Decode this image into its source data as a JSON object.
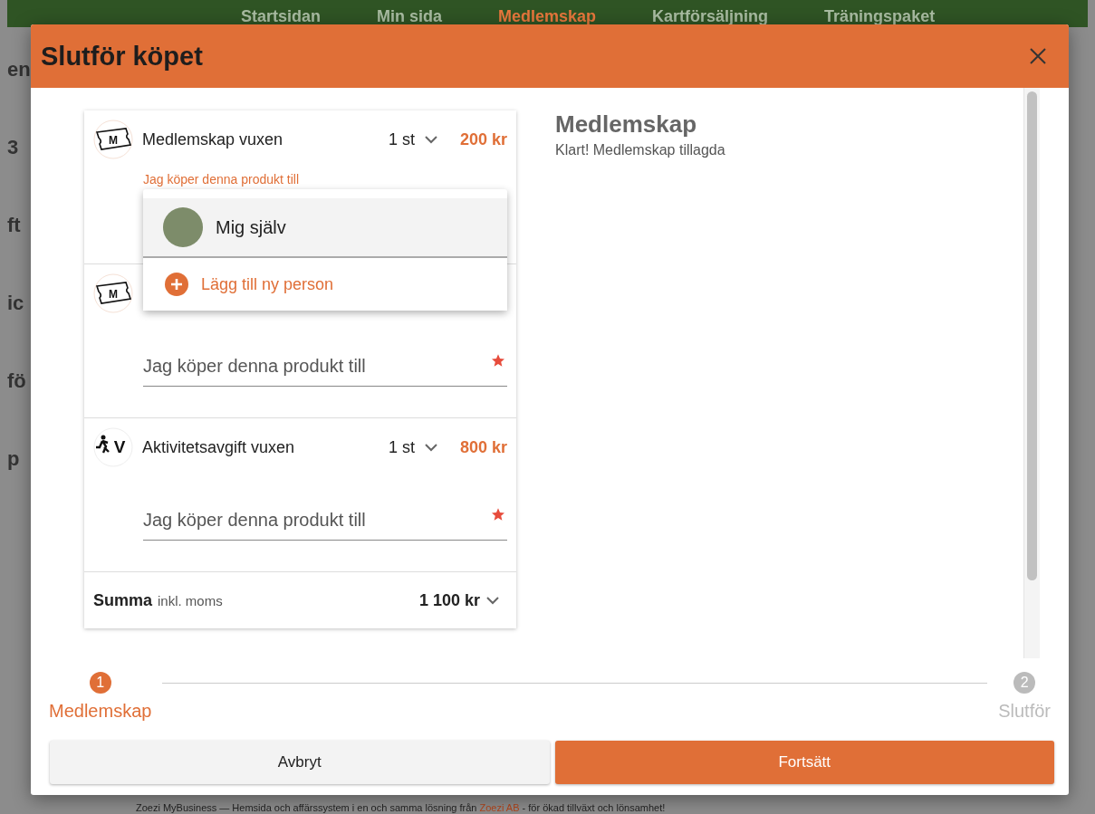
{
  "nav": [
    {
      "label": "Startsidan",
      "selected": false
    },
    {
      "label": "Min sida",
      "selected": false
    },
    {
      "label": "Medlemskap",
      "selected": true
    },
    {
      "label": "Kartförsäljning",
      "selected": false
    },
    {
      "label": "Träningspaket",
      "selected": false
    }
  ],
  "background_fragments": [
    "en",
    "3",
    "ft",
    "ic",
    "fö",
    "p"
  ],
  "dialog": {
    "title": "Slutför köpet"
  },
  "cart": {
    "items": [
      {
        "kind": "ticket",
        "badge": "M",
        "name": "Medlemskap vuxen",
        "quantity": "1 st",
        "price": "200 kr",
        "field_label": "Jag köper denna produkt till",
        "focused": true
      },
      {
        "kind": "ticket",
        "badge": "M",
        "field_label": "Jag köper denna produkt till",
        "focused": false
      },
      {
        "kind": "runner",
        "badge": "V",
        "name": "Aktivitetsavgift vuxen",
        "quantity": "1 st",
        "price": "800 kr",
        "field_label": "Jag köper denna produkt till",
        "focused": false
      }
    ],
    "total_label": "Summa",
    "total_note": "inkl. moms",
    "total": "1 100 kr"
  },
  "dropdown": {
    "options": [
      {
        "kind": "person",
        "label": "Mig själv",
        "selected": true
      },
      {
        "kind": "add",
        "label": "Lägg till ny person",
        "selected": false
      }
    ]
  },
  "summary": {
    "title": "Medlemskap",
    "message": "Klart! Medlemskap tillagda"
  },
  "steps": [
    {
      "number": "1",
      "label": "Medlemskap",
      "selected": true
    },
    {
      "number": "2",
      "label": "Slutför",
      "selected": false
    }
  ],
  "buttons": [
    {
      "kind": "secondary",
      "label": "Avbryt"
    },
    {
      "kind": "primary",
      "label": "Fortsätt"
    }
  ],
  "footer": {
    "text": "Zoezi MyBusiness — Hemsida och affärssystem i en och samma lösning från ",
    "link": "Zoezi AB",
    "after": " - för ökad tillväxt och lönsamhet!"
  }
}
